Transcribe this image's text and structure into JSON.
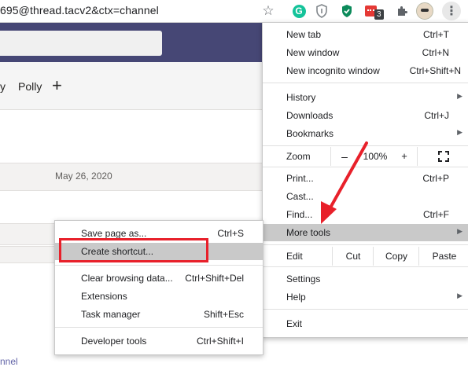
{
  "toolbar": {
    "url_text": "695@thread.tacv2&ctx=channel",
    "extension_badge": "3",
    "grammarly_letter": "G",
    "kebab_glyph": "⋮",
    "star_glyph": "☆",
    "puzzle_glyph": "✚"
  },
  "teams": {
    "tab_partial": "y",
    "tab_polly": "Polly",
    "tab_add": "+",
    "date": "May 26, 2020",
    "bottom_link": "nnel",
    "header_color": "#464775"
  },
  "main_menu": {
    "new_tab": {
      "label": "New tab",
      "shortcut": "Ctrl+T"
    },
    "new_window": {
      "label": "New window",
      "shortcut": "Ctrl+N"
    },
    "new_incognito": {
      "label": "New incognito window",
      "shortcut": "Ctrl+Shift+N"
    },
    "history": {
      "label": "History"
    },
    "downloads": {
      "label": "Downloads",
      "shortcut": "Ctrl+J"
    },
    "bookmarks": {
      "label": "Bookmarks"
    },
    "zoom": {
      "label": "Zoom",
      "minus": "–",
      "value": "100%",
      "plus": "+"
    },
    "print": {
      "label": "Print...",
      "shortcut": "Ctrl+P"
    },
    "cast": {
      "label": "Cast..."
    },
    "find": {
      "label": "Find...",
      "shortcut": "Ctrl+F"
    },
    "more_tools": {
      "label": "More tools"
    },
    "edit": {
      "label": "Edit",
      "cut": "Cut",
      "copy": "Copy",
      "paste": "Paste"
    },
    "settings": {
      "label": "Settings"
    },
    "help": {
      "label": "Help"
    },
    "exit": {
      "label": "Exit"
    }
  },
  "sub_menu": {
    "save_page": {
      "label": "Save page as...",
      "shortcut": "Ctrl+S"
    },
    "create_shortcut": {
      "label": "Create shortcut..."
    },
    "clear_browsing": {
      "label": "Clear browsing data...",
      "shortcut": "Ctrl+Shift+Del"
    },
    "extensions": {
      "label": "Extensions"
    },
    "task_manager": {
      "label": "Task manager",
      "shortcut": "Shift+Esc"
    },
    "developer_tools": {
      "label": "Developer tools",
      "shortcut": "Ctrl+Shift+I"
    }
  },
  "annotation": {
    "highlight_color": "#e8202a"
  }
}
